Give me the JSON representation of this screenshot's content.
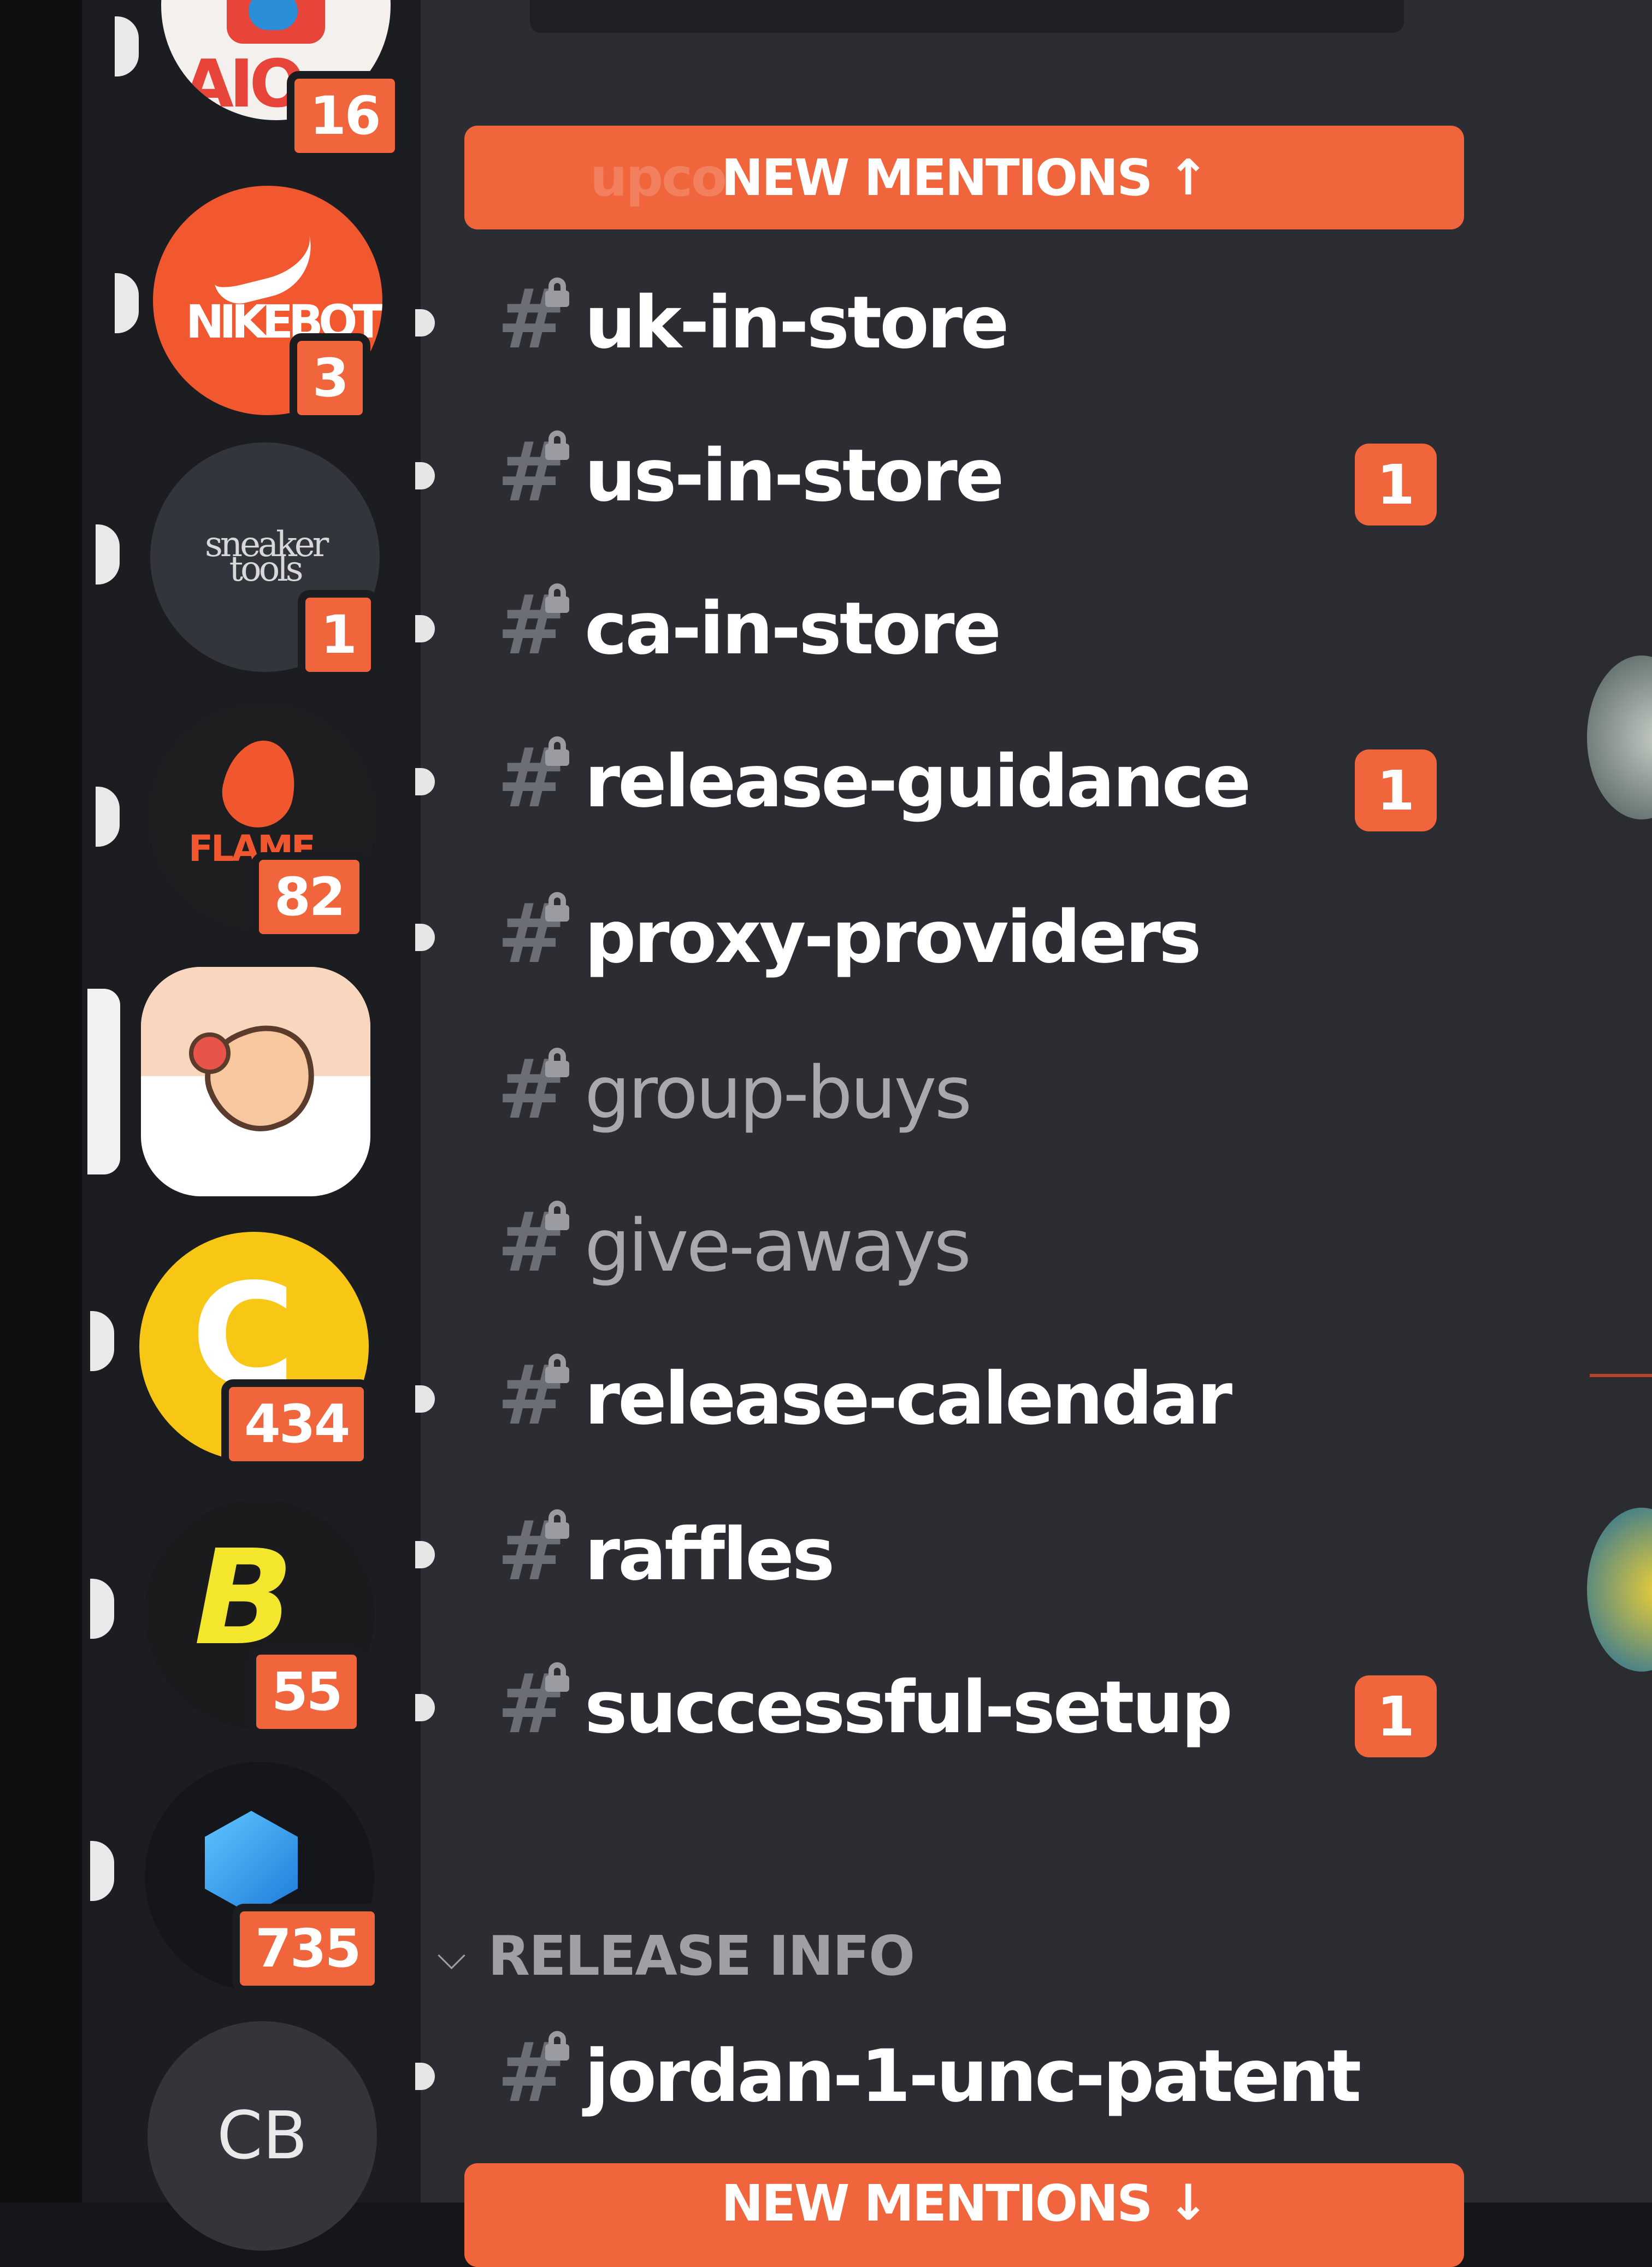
{
  "servers": [
    {
      "name": "aio",
      "initials": "AIO",
      "badge": "16",
      "unread": true
    },
    {
      "name": "nikebot",
      "initials": "NIKEBOT",
      "badge": "3",
      "unread": true
    },
    {
      "name": "sneaker-tools",
      "initials": "sneaker tools",
      "badge": "1",
      "unread": true
    },
    {
      "name": "flame",
      "initials": "FLAME",
      "badge": "82",
      "unread": true
    },
    {
      "name": "peach",
      "initials": "",
      "badge": "",
      "selected": true
    },
    {
      "name": "cc",
      "initials": "",
      "badge": "434",
      "unread": true
    },
    {
      "name": "b-bolt",
      "initials": "",
      "badge": "55",
      "unread": true
    },
    {
      "name": "cube",
      "initials": "",
      "badge": "735",
      "unread": true
    },
    {
      "name": "cb",
      "initials": "CB",
      "badge": ""
    }
  ],
  "new_mentions": {
    "label": "NEW MENTIONS",
    "arrow_up": "↑",
    "arrow_down": "↓",
    "ghost_text": "upco"
  },
  "channels": [
    {
      "name": "uk-in-store",
      "unread": true,
      "badge": ""
    },
    {
      "name": "us-in-store",
      "unread": true,
      "badge": "1"
    },
    {
      "name": "ca-in-store",
      "unread": true,
      "badge": ""
    },
    {
      "name": "release-guidance",
      "unread": true,
      "badge": "1"
    },
    {
      "name": "proxy-providers",
      "unread": true,
      "badge": ""
    },
    {
      "name": "group-buys",
      "unread": false,
      "badge": ""
    },
    {
      "name": "give-aways",
      "unread": false,
      "badge": ""
    },
    {
      "name": "release-calendar",
      "unread": true,
      "badge": ""
    },
    {
      "name": "raffles",
      "unread": true,
      "badge": ""
    },
    {
      "name": "successful-setup",
      "unread": true,
      "badge": "1"
    }
  ],
  "category": {
    "label": "RELEASE INFO",
    "chevron": "⌄"
  },
  "release_channels": [
    {
      "name": "jordan-1-unc-patent",
      "unread": true,
      "badge": ""
    }
  ],
  "icons": {
    "hash": "#",
    "lock": "lock-icon"
  },
  "colors": {
    "accent": "#f0653b",
    "panel": "#2b2d32",
    "rail": "#1c1d21"
  }
}
